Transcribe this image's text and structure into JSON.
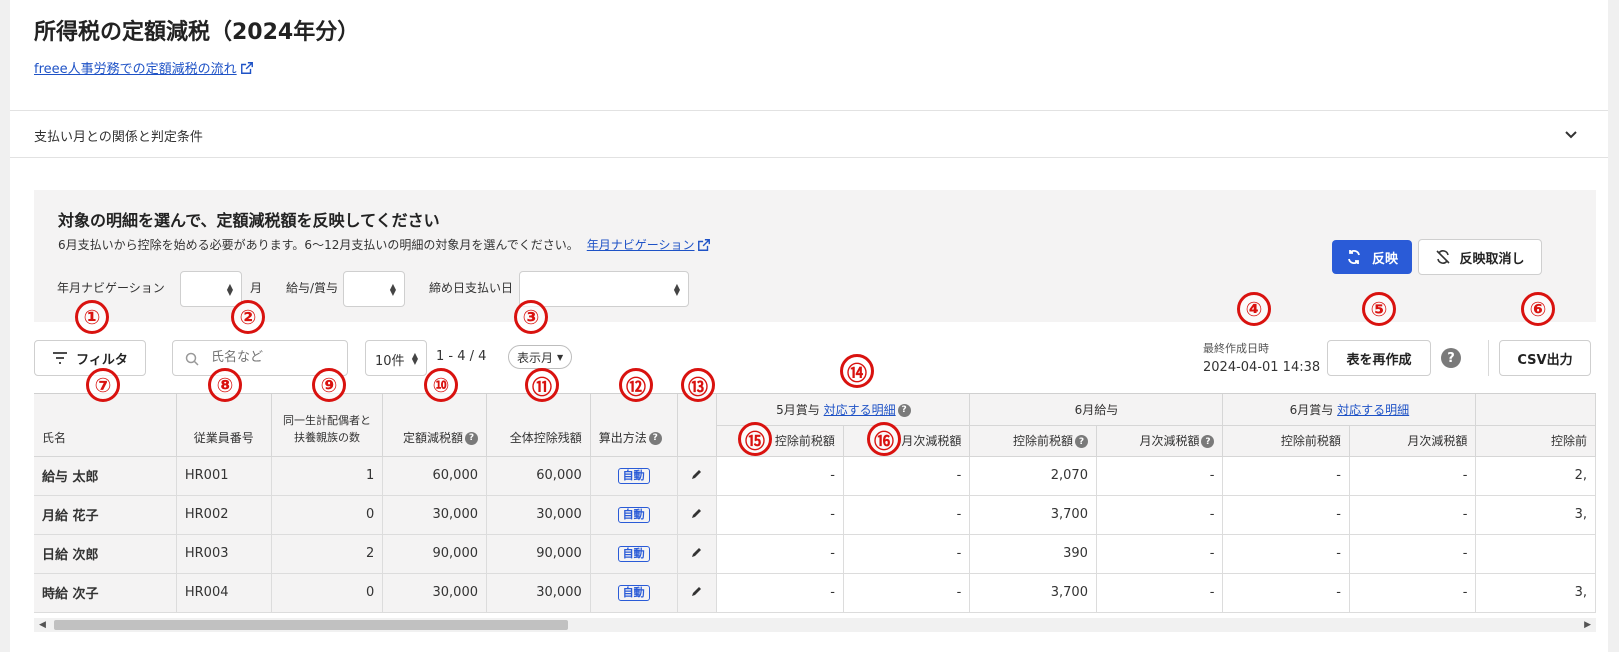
{
  "page": {
    "title": "所得税の定額減税（2024年分）",
    "flow_link": "freee人事労務での定額減税の流れ"
  },
  "accordion": {
    "label": "支払い月との関係と判定条件"
  },
  "panel": {
    "title": "対象の明細を選んで、定額減税額を反映してください",
    "desc": "6月支払いから控除を始める必要があります。6〜12月支払いの明細の対象月を選んでください。",
    "nav_link": "年月ナビゲーション",
    "filter_labels": {
      "year_month": "年月ナビゲーション",
      "month_unit": "月",
      "salary_bonus": "給与/賞与",
      "pay_date": "締め日支払い日"
    },
    "apply_button": "反映",
    "cancel_button": "反映取消し"
  },
  "toolbar": {
    "filter_button": "フィルタ",
    "search_placeholder": "氏名など",
    "per_page": "10件",
    "range": "1 - 4 / 4",
    "display_month": "表示月",
    "last_created_label": "最終作成日時",
    "last_created_value": "2024-04-01 14:38",
    "recreate_button": "表を再作成",
    "csv_button": "CSV出力"
  },
  "annotations": [
    "①",
    "②",
    "③",
    "④",
    "⑤",
    "⑥",
    "⑦",
    "⑧",
    "⑨",
    "⑩",
    "⑪",
    "⑫",
    "⑬",
    "⑭",
    "⑮",
    "⑯"
  ],
  "table": {
    "headers": {
      "name": "氏名",
      "emp_no": "従業員番号",
      "dependents_line1": "同一生計配偶者と",
      "dependents_line2": "扶養親族の数",
      "reduction": "定額減税額",
      "remaining": "全体控除残額",
      "method": "算出方法",
      "may_bonus": "5月賞与",
      "may_bonus_link": "対応する明細",
      "june_salary": "6月給与",
      "june_bonus": "6月賞与",
      "june_bonus_link": "対応する明細",
      "pre_tax": "控除前税額",
      "monthly_reduction": "月次減税額",
      "pre_tax_cut": "控除前"
    },
    "rows": [
      {
        "name": "給与 太郎",
        "emp_no": "HR001",
        "dependents": "1",
        "reduction": "60,000",
        "remaining": "60,000",
        "method": "自動",
        "may_pre": "-",
        "may_red": "-",
        "jun_pre": "2,070",
        "jun_red": "-",
        "junb_pre": "-",
        "junb_red": "-",
        "next": "2,"
      },
      {
        "name": "月給 花子",
        "emp_no": "HR002",
        "dependents": "0",
        "reduction": "30,000",
        "remaining": "30,000",
        "method": "自動",
        "may_pre": "-",
        "may_red": "-",
        "jun_pre": "3,700",
        "jun_red": "-",
        "junb_pre": "-",
        "junb_red": "-",
        "next": "3,"
      },
      {
        "name": "日給 次郎",
        "emp_no": "HR003",
        "dependents": "2",
        "reduction": "90,000",
        "remaining": "90,000",
        "method": "自動",
        "may_pre": "-",
        "may_red": "-",
        "jun_pre": "390",
        "jun_red": "-",
        "junb_pre": "-",
        "junb_red": "-",
        "next": ""
      },
      {
        "name": "時給 次子",
        "emp_no": "HR004",
        "dependents": "0",
        "reduction": "30,000",
        "remaining": "30,000",
        "method": "自動",
        "may_pre": "-",
        "may_red": "-",
        "jun_pre": "3,700",
        "jun_red": "-",
        "junb_pre": "-",
        "junb_red": "-",
        "next": "3,"
      }
    ]
  },
  "colors": {
    "primary": "#2a5bd7",
    "annotation": "#d9120f",
    "link": "#1e52c6"
  }
}
